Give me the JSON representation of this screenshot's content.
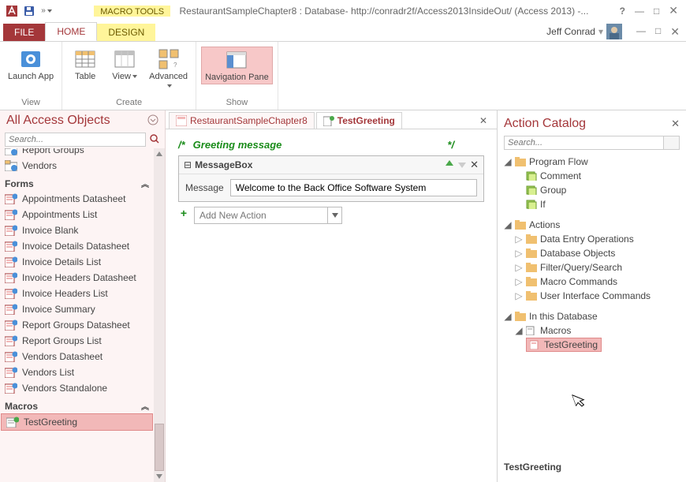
{
  "title_bar": {
    "macro_tools": "MACRO TOOLS",
    "title": "RestaurantSampleChapter8 : Database- http://conradr2f/Access2013InsideOut/ (Access 2013) -...",
    "user": "Jeff Conrad"
  },
  "tabs": {
    "file": "FILE",
    "home": "HOME",
    "design": "DESIGN"
  },
  "ribbon": {
    "launch_app": "Launch App",
    "table": "Table",
    "view": "View",
    "advanced": "Advanced",
    "navigation_pane": "Navigation Pane",
    "group_view": "View",
    "group_create": "Create",
    "group_show": "Show"
  },
  "nav": {
    "title": "All Access Objects",
    "search_placeholder": "Search...",
    "items_cut_top": "Report Groups",
    "items_top": [
      "Vendors"
    ],
    "section_forms": "Forms",
    "forms": [
      "Appointments Datasheet",
      "Appointments List",
      "Invoice Blank",
      "Invoice Details Datasheet",
      "Invoice Details List",
      "Invoice Headers Datasheet",
      "Invoice Headers List",
      "Invoice Summary",
      "Report Groups Datasheet",
      "Report Groups List",
      "Vendors Datasheet",
      "Vendors List",
      "Vendors Standalone"
    ],
    "section_macros": "Macros",
    "macros": [
      "TestGreeting"
    ]
  },
  "docs": {
    "tab1": "RestaurantSampleChapter8",
    "tab2": "TestGreeting"
  },
  "editor": {
    "comment": "Greeting message",
    "block_title": "MessageBox",
    "param_label": "Message",
    "param_value": "Welcome to the Back Office Software System",
    "add_action": "Add New Action"
  },
  "catalog": {
    "title": "Action Catalog",
    "search_placeholder": "Search...",
    "program_flow": "Program Flow",
    "pf_items": [
      "Comment",
      "Group",
      "If"
    ],
    "actions": "Actions",
    "actions_items": [
      "Data Entry Operations",
      "Database Objects",
      "Filter/Query/Search",
      "Macro Commands",
      "User Interface Commands"
    ],
    "in_db": "In this Database",
    "macros": "Macros",
    "test_greeting": "TestGreeting",
    "detail": "TestGreeting"
  }
}
